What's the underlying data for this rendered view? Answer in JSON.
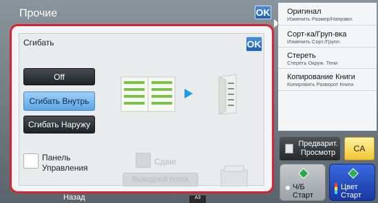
{
  "header": {
    "title": "Прочие",
    "ok_label": "OK"
  },
  "panel": {
    "title": "Сгибать",
    "ok_label": "OK",
    "buttons": {
      "off": "Off",
      "inner": "Сгибать Внутрь",
      "outer": "Сгибать Наружу"
    },
    "selected": "inner",
    "checkbox_label": "Панель Управления",
    "shift_label": "Сдвиг",
    "output_tray_label": "Выводной поток"
  },
  "sidebar": {
    "items": [
      {
        "title": "Оригинал",
        "subtitle": "Изменить Размер/Направл."
      },
      {
        "title": "Сорт-ка/Груп-вка",
        "subtitle": "Изменить Сорт./Групп."
      },
      {
        "title": "Стереть",
        "subtitle": "Стереть Окруж. Тени"
      },
      {
        "title": "Копирование Книги",
        "subtitle": "Копировать Разворот Книги"
      }
    ]
  },
  "actions": {
    "preview_label": "Предварит. Просмотр",
    "ca_label": "CA",
    "bw_start_label": "Ч/Б Старт",
    "color_start_label": "Цвет Старт"
  },
  "footer": {
    "back_label": "Назад",
    "paper": "A3"
  },
  "colors": {
    "accent_red": "#d9232f",
    "ok_blue": "#1f5fb0",
    "selected_blue": "#5aa5e6",
    "ca_yellow": "#f2c531",
    "color_start": "#2a55c9",
    "bw_start": "#a8acb0"
  }
}
